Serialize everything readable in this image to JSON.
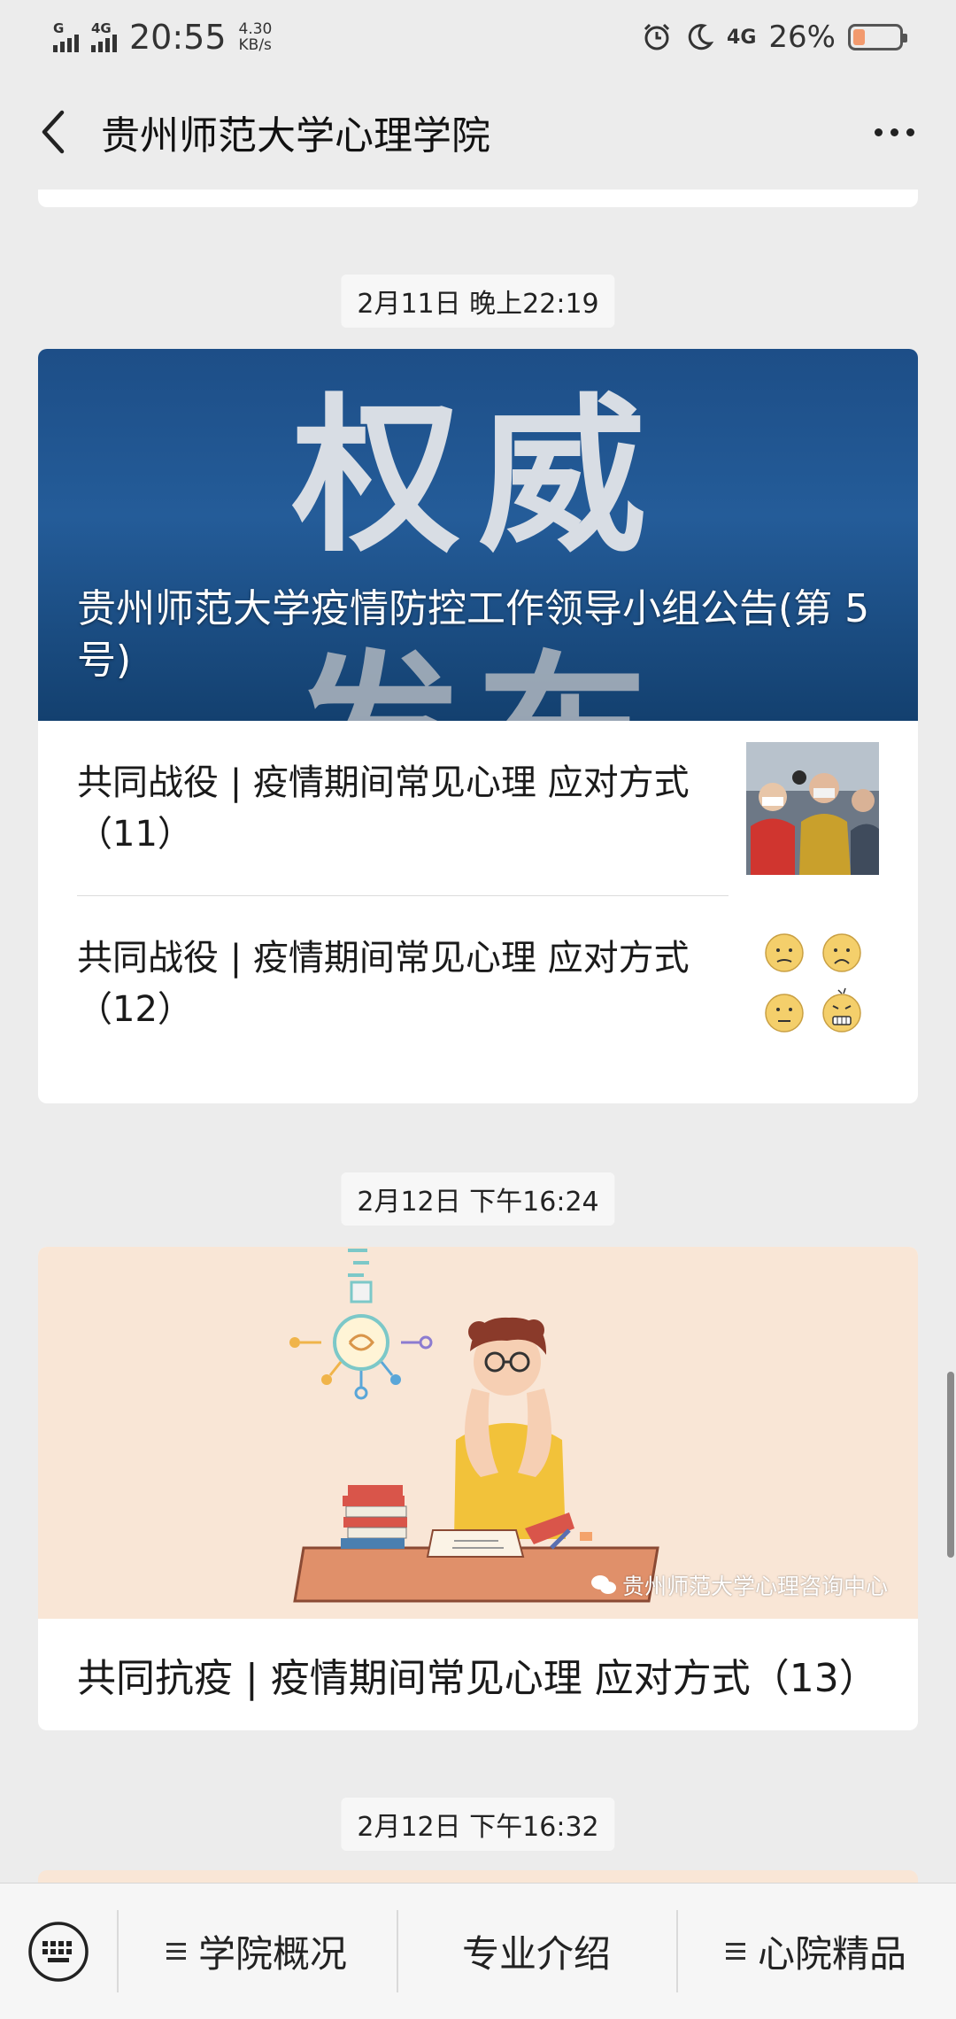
{
  "status_bar": {
    "network_left": "G",
    "network_right": "4G",
    "time": "20:55",
    "speed_value": "4.30",
    "speed_unit": "KB/s",
    "network_type": "4G",
    "battery_percent": "26%",
    "battery_level": 0.26
  },
  "header": {
    "title": "贵州师范大学心理学院"
  },
  "feed": {
    "group1": {
      "timestamp": "2月11日 晚上22:19",
      "hero_bg_top": "权威",
      "hero_bg_bottom": "发布",
      "hero_title": "贵州师范大学疫情防控工作领导小组公告(第 5 号)",
      "items": [
        {
          "title": "共同战役 | 疫情期间常见心理 应对方式（11）"
        },
        {
          "title": "共同战役 | 疫情期间常见心理 应对方式（12）"
        }
      ]
    },
    "group2": {
      "timestamp": "2月12日 下午16:24",
      "title": "共同抗疫 | 疫情期间常见心理 应对方式（13）",
      "watermark": "贵州师范大学心理咨询中心"
    },
    "group3": {
      "timestamp": "2月12日 下午16:32"
    }
  },
  "bottom_menu": {
    "items": [
      {
        "label": "学院概况",
        "has_submenu": true
      },
      {
        "label": "专业介绍",
        "has_submenu": false
      },
      {
        "label": "心院精品",
        "has_submenu": true
      }
    ]
  },
  "icons": {
    "back": "chevron-left-icon",
    "more": "more-dots-icon",
    "keyboard": "keyboard-icon",
    "alarm": "alarm-icon",
    "moon": "moon-icon"
  }
}
